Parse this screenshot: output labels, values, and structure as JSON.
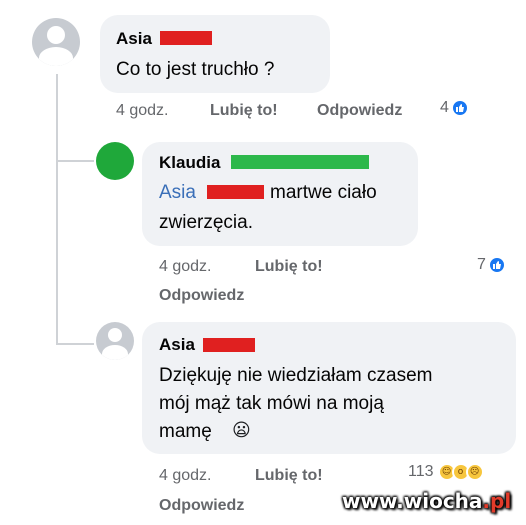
{
  "comments": [
    {
      "author": "Asia",
      "text": "Co to jest truchło ?",
      "time": "4 godz.",
      "like_label": "Lubię to!",
      "reply_label": "Odpowiedz",
      "reaction_count": "4",
      "reaction_icons": [
        "like-icon"
      ]
    },
    {
      "author": "Klaudia",
      "mention": "Asia",
      "text_line1": "martwe ciało",
      "text_line2": "zwierzęcia.",
      "time": "4 godz.",
      "like_label": "Lubię to!",
      "reply_label": "Odpowiedz",
      "reaction_count": "7",
      "reaction_icons": [
        "like-icon"
      ],
      "avatar_color": "#1fa83a"
    },
    {
      "author": "Asia",
      "text_line1": "Dziękuję nie wiedziałam czasem",
      "text_line2": "mój mąż tak mówi na moją",
      "text_line3": "mamę",
      "text_emoji": "😦",
      "time": "4 godz.",
      "like_label": "Lubię to!",
      "reply_label": "Odpowiedz",
      "reaction_count": "113",
      "reaction_icons": [
        "haha-icon",
        "wow-icon",
        "sad-icon"
      ]
    }
  ],
  "watermark": {
    "text_main": "www.wiocha",
    "text_accent": ".pl"
  },
  "colors": {
    "bubble": "#f0f2f5",
    "redact_red": "#e02020",
    "redact_green": "#2db84b",
    "like_blue": "#1877f2"
  }
}
